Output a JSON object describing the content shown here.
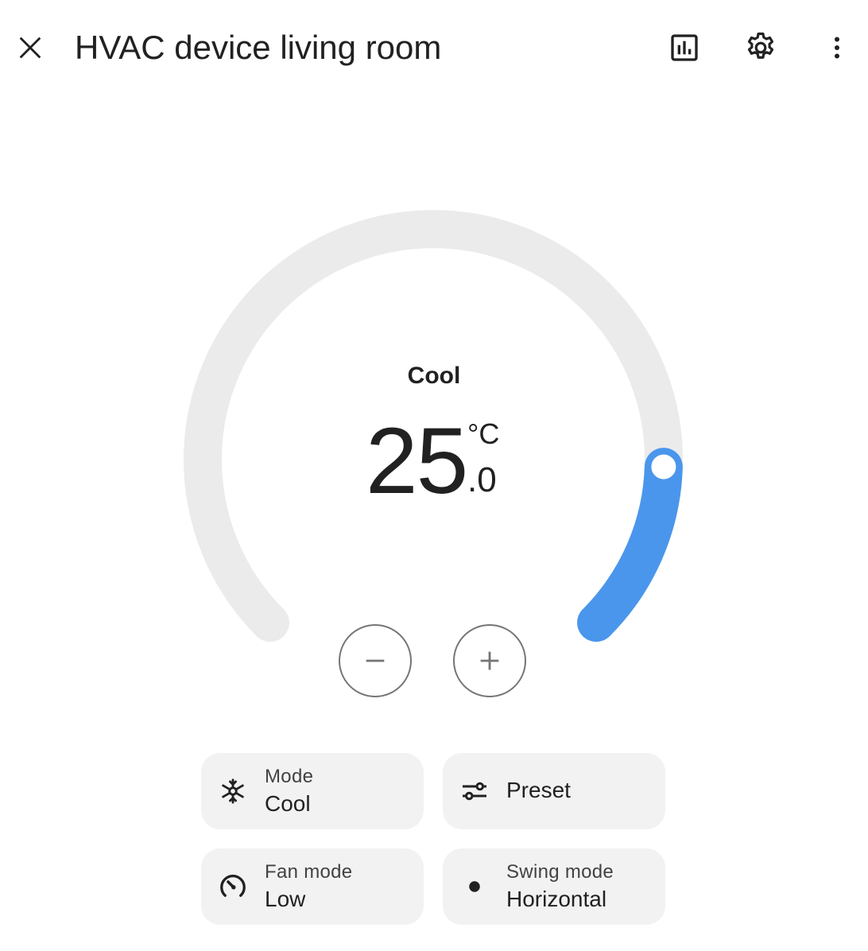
{
  "header": {
    "title": "HVAC device living room",
    "close_icon": "close-icon",
    "history_icon": "bar-chart-icon",
    "settings_icon": "gear-icon",
    "more_icon": "more-vertical-icon"
  },
  "thermostat": {
    "hvac_mode": "Cool",
    "target_whole": "25",
    "target_decimal": ".0",
    "unit": "°C",
    "setpoint_fraction": 0.84,
    "colors": {
      "track": "#ebebeb",
      "active": "#4a96ec"
    },
    "minus_icon": "minus-icon",
    "plus_icon": "plus-icon"
  },
  "controls": {
    "mode": {
      "label": "Mode",
      "value": "Cool",
      "icon": "snowflake-icon"
    },
    "preset": {
      "label": "Preset",
      "icon": "tune-icon"
    },
    "fan_mode": {
      "label": "Fan mode",
      "value": "Low",
      "icon": "fan-speed-icon"
    },
    "swing_mode": {
      "label": "Swing mode",
      "value": "Horizontal",
      "icon": "dot-icon"
    }
  }
}
